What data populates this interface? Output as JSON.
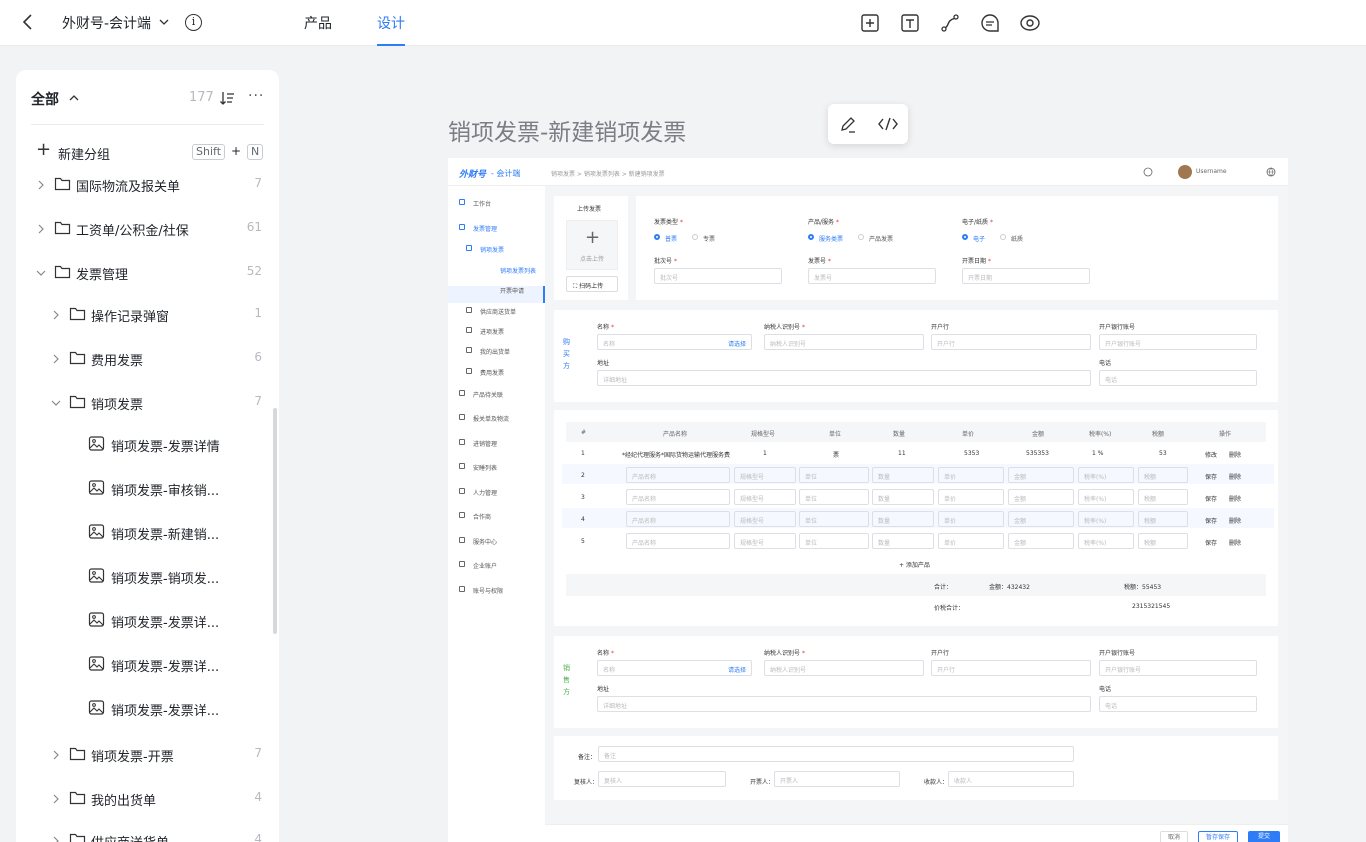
{
  "topbar": {
    "project": "外财号-会计端",
    "tabs": [
      "产品",
      "设计"
    ],
    "active_tab": "设计",
    "accent": "#2e7cf6"
  },
  "sidebar": {
    "title": "全部",
    "count": "177",
    "more": "···",
    "new_group": "新建分组",
    "shortcut_key1": "Shift",
    "shortcut_plus": "+",
    "shortcut_key2": "N",
    "items": [
      {
        "label": "国际物流及报关单",
        "count": "7",
        "type": "folder"
      },
      {
        "label": "工资单/公积金/社保",
        "count": "61",
        "type": "folder"
      },
      {
        "label": "发票管理",
        "count": "52",
        "type": "folder"
      },
      {
        "label": "操作记录弹窗",
        "count": "1",
        "type": "folder"
      },
      {
        "label": "费用发票",
        "count": "6",
        "type": "folder"
      },
      {
        "label": "销项发票",
        "count": "7",
        "type": "folder"
      },
      {
        "label": "销项发票-发票详情",
        "count": "",
        "type": "page"
      },
      {
        "label": "销项发票-审核销...",
        "count": "",
        "type": "page"
      },
      {
        "label": "销项发票-新建销...",
        "count": "",
        "type": "page"
      },
      {
        "label": "销项发票-销项发...",
        "count": "",
        "type": "page"
      },
      {
        "label": "销项发票-发票详...",
        "count": "",
        "type": "page"
      },
      {
        "label": "销项发票-发票详...",
        "count": "",
        "type": "page"
      },
      {
        "label": "销项发票-发票详...",
        "count": "",
        "type": "page"
      },
      {
        "label": "销项发票-开票",
        "count": "7",
        "type": "folder"
      },
      {
        "label": "我的出货单",
        "count": "4",
        "type": "folder"
      },
      {
        "label": "供应商送货单",
        "count": "4",
        "type": "folder"
      }
    ]
  },
  "canvas": {
    "title": "销项发票-新建销项发票"
  },
  "frame": {
    "logo": "外财号",
    "logo_sub": "- 会计端",
    "breadcrumb": "销项发票  >  销项发票列表  >  新建销项发票",
    "username": "Username",
    "nav": [
      "工作台",
      "发票管理",
      "销项发票",
      "销项发票列表",
      "开票申请",
      "供应商送货单",
      "进项发票",
      "我的出货单",
      "费用发票",
      "产品待关联",
      "报关单及物流",
      "进销管理",
      "安睡列表",
      "人力管理",
      "合作商",
      "服务中心",
      "企业账户",
      "账号与权限"
    ],
    "upload": {
      "title": "上传发票",
      "click": "点击上传",
      "scan": "扫码上传"
    },
    "invoice": {
      "type_label": "发票类型",
      "type_opts": [
        "普票",
        "专票"
      ],
      "product_label": "产品/服务",
      "product_opts": [
        "服务类票",
        "产品发票"
      ],
      "paper_label": "电子/纸质",
      "paper_opts": [
        "电子",
        "纸质"
      ],
      "batch_label": "批次号",
      "batch_ph": "批次号",
      "no_label": "发票号",
      "no_ph": "发票号",
      "date_label": "开票日期",
      "date_ph": "开票日期"
    },
    "buyer": {
      "side": [
        "购",
        "买",
        "方"
      ],
      "name_label": "名称",
      "name_ph": "名称",
      "select": "请选择",
      "tax_label": "纳税人识别号",
      "tax_ph": "纳税人识别号",
      "bank_label": "开户行",
      "bank_ph": "开户行",
      "acct_label": "开户银行账号",
      "acct_ph": "开户银行账号",
      "addr_label": "地址",
      "addr_ph": "详细地址",
      "tel_label": "电话",
      "tel_ph": "电话"
    },
    "table": {
      "headers": [
        "#",
        "产品名称",
        "规格型号",
        "单位",
        "数量",
        "单价",
        "金额",
        "税率(%)",
        "税额",
        "操作"
      ],
      "row1": [
        "1",
        "*经纪代理服务*国际货物运输代理服务费",
        "1",
        "票",
        "11",
        "5353",
        "535353",
        "1 %",
        "53"
      ],
      "row1_ops": [
        "修改",
        "删除"
      ],
      "placeholders": [
        "产品名称",
        "规格型号",
        "单位",
        "数量",
        "单价",
        "金额",
        "税率(%)",
        "税额"
      ],
      "row_ops": [
        "保存",
        "删除"
      ],
      "add": "+ 添加产品",
      "total_label": "合计：",
      "amount_label": "金额：432432",
      "tax_label": "税额：55453",
      "grand_label": "价税合计：",
      "grand_value": "2315321545"
    },
    "seller": {
      "side": [
        "销",
        "售",
        "方"
      ]
    },
    "footer": {
      "remark_label": "备注：",
      "remark_ph": "备注",
      "reviewer_label": "复核人：",
      "reviewer_ph": "复核人",
      "drawer_label": "开票人：",
      "drawer_ph": "开票人",
      "payee_label": "收款人：",
      "payee_ph": "收款人"
    },
    "actions": [
      "取消",
      "暂存保存",
      "提交"
    ]
  }
}
